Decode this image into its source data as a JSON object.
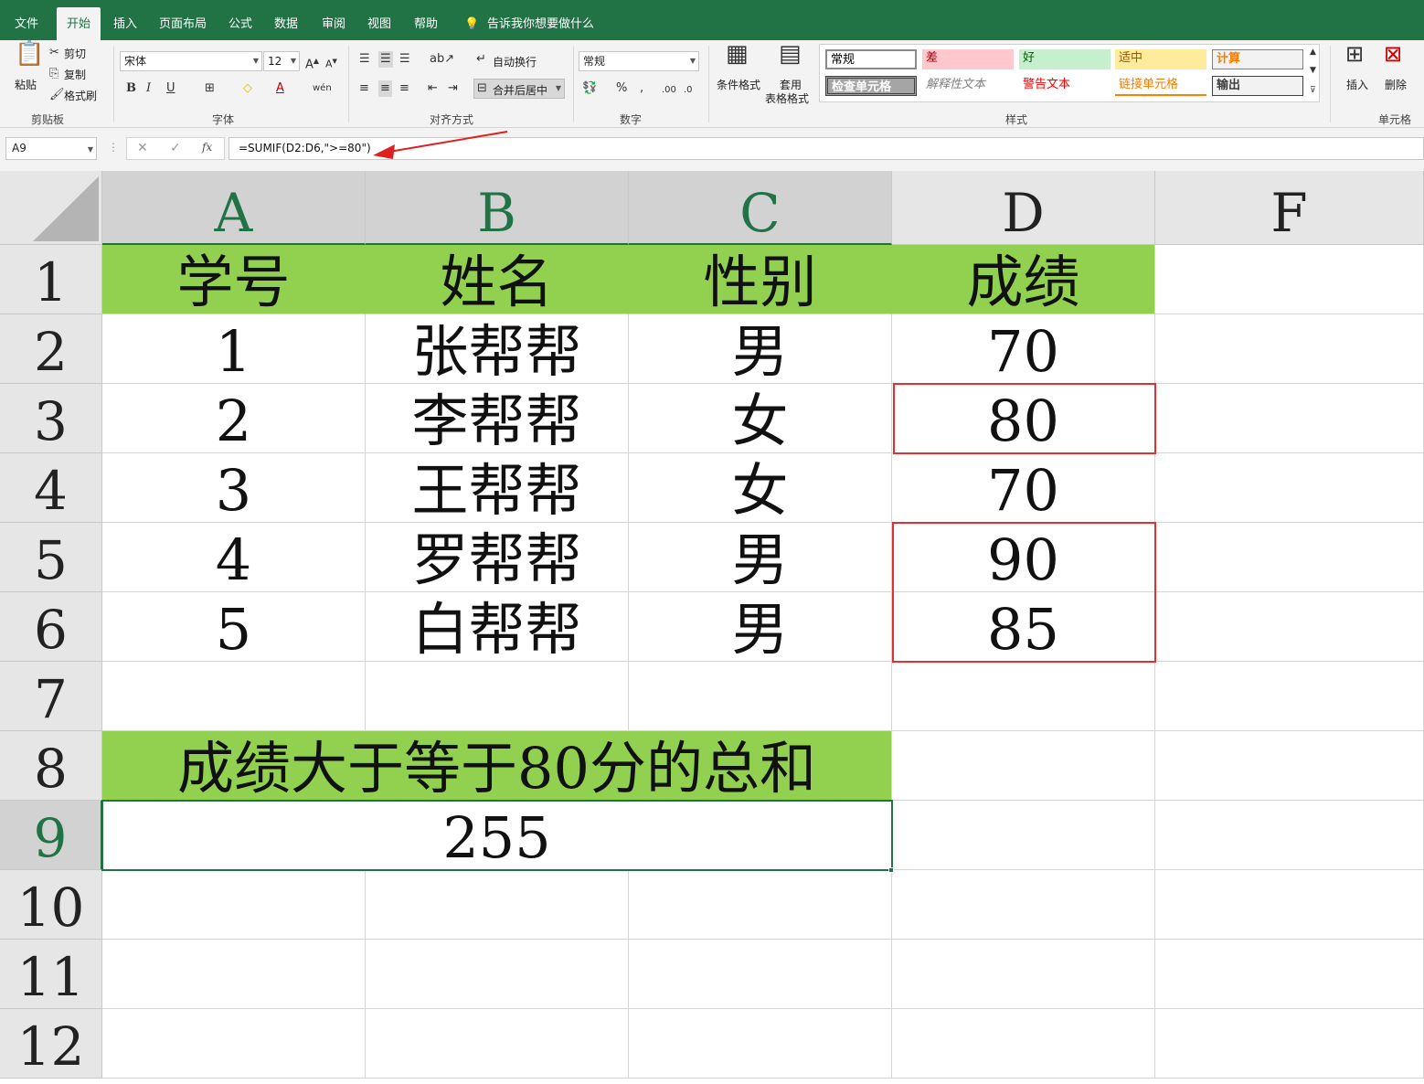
{
  "ribbon_tabs": [
    "文件",
    "开始",
    "插入",
    "页面布局",
    "公式",
    "数据",
    "审阅",
    "视图",
    "帮助"
  ],
  "tell_me": "告诉我你想要做什么",
  "clipboard": {
    "paste": "粘贴",
    "cut": "剪切",
    "copy": "复制",
    "format_painter": "格式刷",
    "group": "剪贴板"
  },
  "font": {
    "name": "宋体",
    "size": "12",
    "bold": "B",
    "italic": "I",
    "underline": "U",
    "group": "字体"
  },
  "alignment": {
    "wrap": "自动换行",
    "merge": "合并后居中",
    "group": "对齐方式"
  },
  "number": {
    "format": "常规",
    "percent": "%",
    "comma": ",",
    "group": "数字"
  },
  "styles": {
    "conditional": "条件格式",
    "table_line1": "套用",
    "table_line2": "表格格式",
    "group": "样式",
    "items": [
      "常规",
      "差",
      "好",
      "适中",
      "计算",
      "检查单元格",
      "解释性文本",
      "警告文本",
      "链接单元格",
      "输出"
    ]
  },
  "cells_group": {
    "insert": "插入",
    "delete": "删除",
    "group": "单元格"
  },
  "formula_bar": {
    "name_box": "A9",
    "cancel": "✕",
    "enter": "✓",
    "fx": "fx",
    "formula": "=SUMIF(D2:D6,\">=80\")"
  },
  "columns": [
    "A",
    "B",
    "C",
    "D",
    "F"
  ],
  "rows": [
    "1",
    "2",
    "3",
    "4",
    "5",
    "6",
    "7",
    "8",
    "9",
    "10",
    "11",
    "12"
  ],
  "table": {
    "headers": [
      "学号",
      "姓名",
      "性别",
      "成绩"
    ],
    "data": [
      [
        "1",
        "张帮帮",
        "男",
        "70"
      ],
      [
        "2",
        "李帮帮",
        "女",
        "80"
      ],
      [
        "3",
        "王帮帮",
        "女",
        "70"
      ],
      [
        "4",
        "罗帮帮",
        "男",
        "90"
      ],
      [
        "5",
        "白帮帮",
        "男",
        "85"
      ]
    ],
    "summary_label": "成绩大于等于80分的总和",
    "summary_value": "255"
  },
  "colors": {
    "accent": "#217346",
    "header_fill": "#92d050",
    "highlight_border": "#e03030"
  }
}
